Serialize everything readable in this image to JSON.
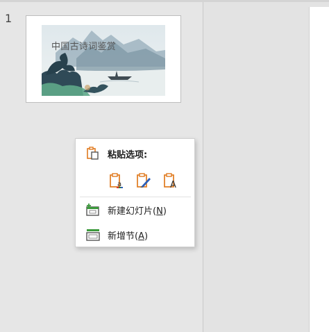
{
  "thumbnail_pane": {
    "slide_number": "1",
    "slide_title": "中国古诗词鉴赏"
  },
  "context_menu": {
    "paste_header": "粘贴选项:",
    "paste_options": [
      {
        "name": "use-destination-theme",
        "icon": "clipboard-a-icon"
      },
      {
        "name": "keep-source-formatting",
        "icon": "clipboard-brush-icon"
      },
      {
        "name": "keep-text-only",
        "icon": "clipboard-A-icon"
      }
    ],
    "new_slide_label": "新建幻灯片(",
    "new_slide_key": "N",
    "new_slide_close": ")",
    "new_section_label": "新增节(",
    "new_section_key": "A",
    "new_section_close": ")"
  },
  "colors": {
    "accent_orange": "#e07a1f",
    "icon_green": "#3c9a3c",
    "background": "#e6e6e6"
  }
}
